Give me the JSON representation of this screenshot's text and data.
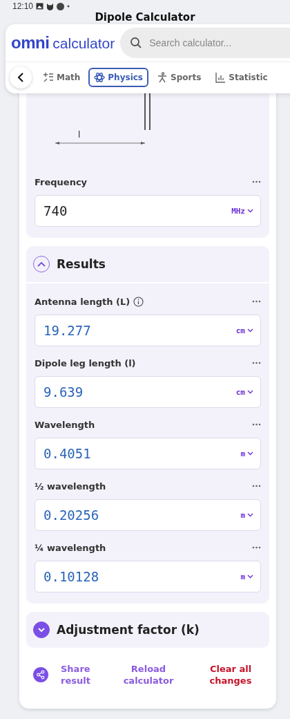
{
  "status_bar": {
    "time": "12:10"
  },
  "page_title": "Dipole Calculator",
  "header": {
    "logo_brand": "omni",
    "logo_word": "calculator",
    "search": {
      "placeholder": "Search calculator..."
    }
  },
  "tabs": [
    {
      "label": "Math",
      "kind": "math",
      "selected": false
    },
    {
      "label": "Physics",
      "kind": "physics",
      "selected": true
    },
    {
      "label": "Sports",
      "kind": "sports",
      "selected": false
    },
    {
      "label": "Statistic",
      "kind": "statistics",
      "selected": false
    }
  ],
  "diagram": {
    "label": "l"
  },
  "inputs": [
    {
      "label": "Frequency",
      "value": "740",
      "unit": "MHz"
    }
  ],
  "sections": [
    {
      "title": "Results",
      "expanded": true,
      "fields": [
        {
          "label": "Antenna length (L)",
          "info": true,
          "value": "19.277",
          "unit": "cm"
        },
        {
          "label": "Dipole leg length (l)",
          "info": false,
          "value": "9.639",
          "unit": "cm"
        },
        {
          "label": "Wavelength",
          "info": false,
          "value": "0.4051",
          "unit": "m"
        },
        {
          "label": "½ wavelength",
          "info": false,
          "value": "0.20256",
          "unit": "m"
        },
        {
          "label": "¼ wavelength",
          "info": false,
          "value": "0.10128",
          "unit": "m"
        }
      ]
    },
    {
      "title": "Adjustment factor (k)",
      "expanded": false
    }
  ],
  "actions": [
    {
      "label": "Share result",
      "kind": "share"
    },
    {
      "label": "Reload calculator",
      "kind": "reload"
    },
    {
      "label": "Clear all changes",
      "kind": "clear"
    }
  ]
}
